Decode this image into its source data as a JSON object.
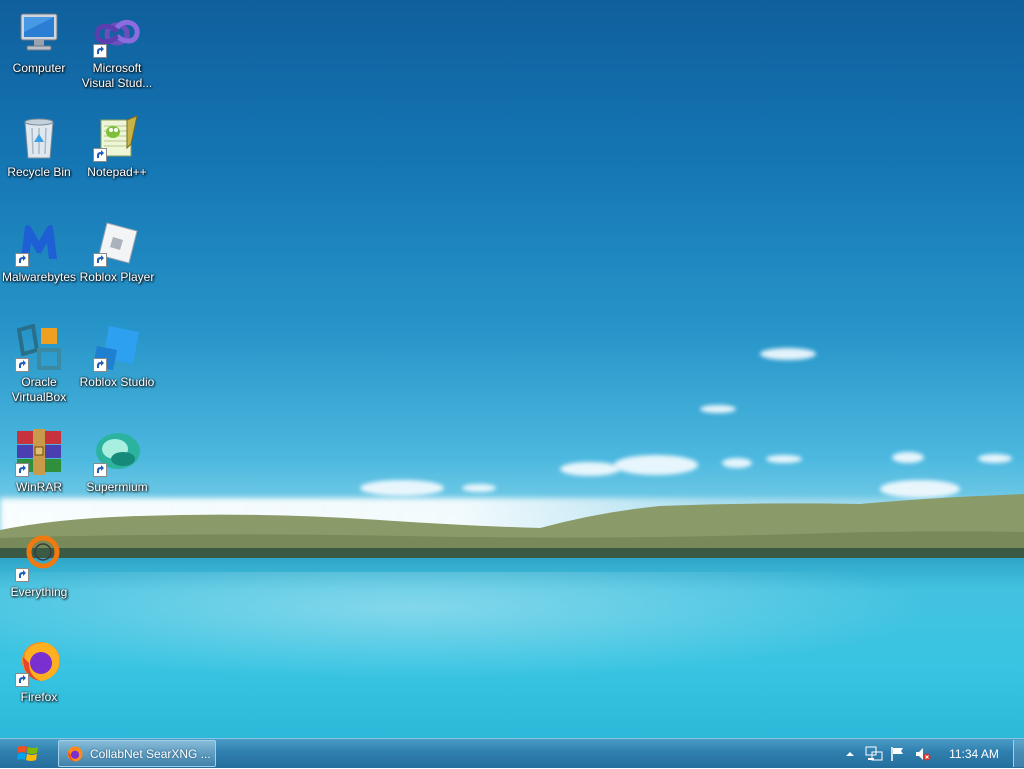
{
  "desktop": {
    "icons": [
      {
        "label": "Computer",
        "icon": "computer-icon"
      },
      {
        "label": "Microsoft Visual Stud...",
        "icon": "visual-studio-icon"
      },
      {
        "label": "Recycle Bin",
        "icon": "recycle-bin-icon"
      },
      {
        "label": "Notepad++",
        "icon": "notepad-plus-plus-icon"
      },
      {
        "label": "Malwarebytes",
        "icon": "malwarebytes-icon"
      },
      {
        "label": "Roblox Player",
        "icon": "roblox-player-icon"
      },
      {
        "label": "Oracle VirtualBox",
        "icon": "virtualbox-icon"
      },
      {
        "label": "Roblox Studio",
        "icon": "roblox-studio-icon"
      },
      {
        "label": "WinRAR",
        "icon": "winrar-icon"
      },
      {
        "label": "Supermium",
        "icon": "supermium-icon"
      },
      {
        "label": "Everything",
        "icon": "everything-icon"
      },
      {
        "label": "Firefox",
        "icon": "firefox-icon"
      }
    ]
  },
  "taskbar": {
    "start_icon": "windows-logo-icon",
    "task_button": {
      "label": "CollabNet SearXNG ...",
      "icon": "firefox-icon"
    },
    "tray_icons": [
      "show-hidden-icons-arrow",
      "network-icon",
      "action-center-flag-icon",
      "volume-muted-icon"
    ],
    "clock": "11:34 AM"
  }
}
